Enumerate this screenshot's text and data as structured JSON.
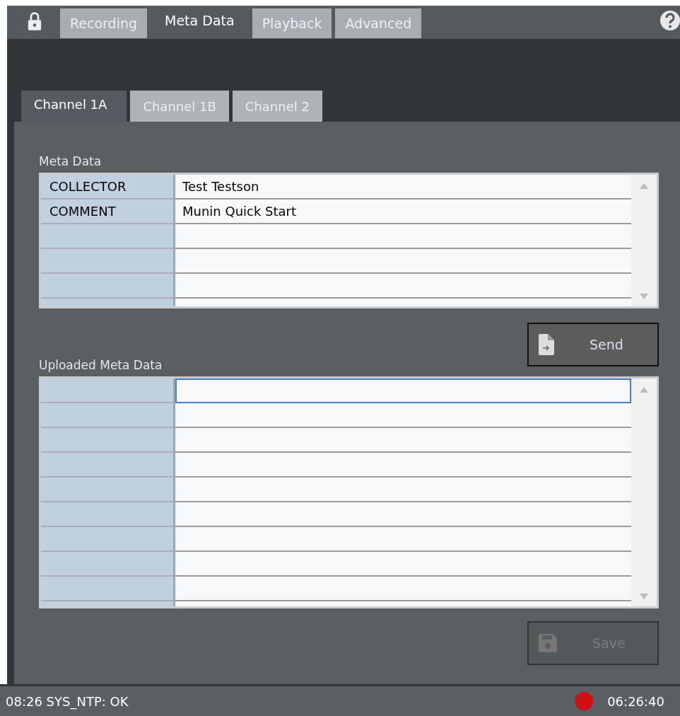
{
  "main_tabs": [
    {
      "label": "Recording",
      "selected": false
    },
    {
      "label": "Meta Data",
      "selected": true
    },
    {
      "label": "Playback",
      "selected": false
    },
    {
      "label": "Advanced",
      "selected": false
    }
  ],
  "channel_tabs": [
    {
      "label": "Channel 1A",
      "selected": true
    },
    {
      "label": "Channel 1B",
      "selected": false
    },
    {
      "label": "Channel 2",
      "selected": false
    }
  ],
  "meta_data": {
    "title": "Meta Data",
    "rows": [
      {
        "key": "COLLECTOR",
        "value": "Test Testson",
        "selected": false
      },
      {
        "key": "COMMENT",
        "value": "Munin Quick Start",
        "selected": false
      }
    ]
  },
  "send_button": {
    "label": "Send",
    "disabled": false
  },
  "uploaded_meta_data": {
    "title": "Uploaded Meta Data",
    "rows": [
      {
        "selected": true
      }
    ]
  },
  "save_button": {
    "label": "Save",
    "disabled": true
  },
  "status_bar": {
    "left": "08:26 SYS_NTP: OK",
    "time": "06:26:40"
  }
}
